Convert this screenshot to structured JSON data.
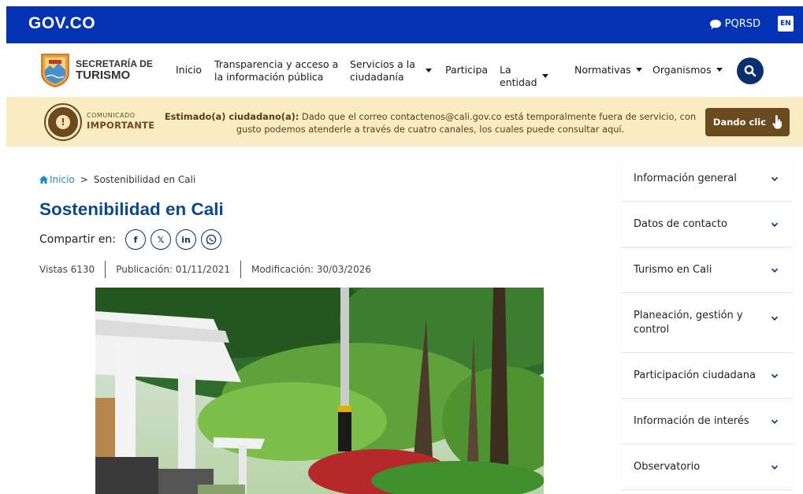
{
  "govbar": {
    "logo": "GOV.CO",
    "pqrsd": "PQRSD",
    "lang": "EN"
  },
  "header": {
    "logo_line1": "SECRETARÍA DE",
    "logo_line2": "TURISMO",
    "nav": [
      {
        "label": "Inicio"
      },
      {
        "label": "Transparencia y acceso a la información pública"
      },
      {
        "label": "Servicios a la ciudadanía",
        "dropdown": true
      },
      {
        "label": "Participa"
      },
      {
        "label": "La entidad",
        "dropdown": true
      },
      {
        "label": "Normativas",
        "dropdown": true
      },
      {
        "label": "Organismos",
        "dropdown": true
      }
    ]
  },
  "notice": {
    "tag_small": "COMUNICADO",
    "tag_big": "IMPORTANTE",
    "greeting": "Estimado(a) ciudadano(a):",
    "message": " Dado que el correo contactenos@cali.gov.co está temporalmente fuera de servicio, con gusto podemos atenderle a través de cuatro canales, los cuales puede consultar aquí.",
    "button": "Dando clic"
  },
  "content": {
    "breadcrumb": {
      "home": "Inicio",
      "current": "Sostenibilidad en Cali"
    },
    "title": "Sostenibilidad en Cali",
    "share_label": "Compartir en:",
    "meta": {
      "views": "Vistas 6130",
      "published": "Publicación: 01/11/2021",
      "modified": "Modificación: 30/03/2026"
    }
  },
  "sidebar": {
    "items": [
      {
        "label": "Información general"
      },
      {
        "label": "Datos de contacto"
      },
      {
        "label": "Turismo en Cali"
      },
      {
        "label": "Planeación, gestión y control"
      },
      {
        "label": "Participación ciudadana"
      },
      {
        "label": "Información de interés"
      },
      {
        "label": "Observatorio"
      }
    ]
  },
  "colors": {
    "govbar": "#0433b4",
    "title": "#0a4a8a",
    "notice_bg": "#f9ecc4",
    "notice_accent": "#6b4a1d"
  }
}
